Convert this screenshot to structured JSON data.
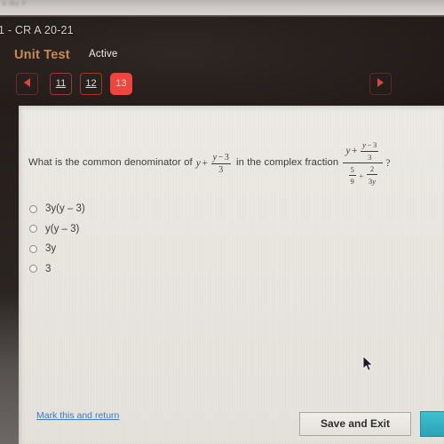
{
  "browser": {
    "ghost_tab_text": "e  My F"
  },
  "app": {
    "course_title": "1 - CR A 20-21",
    "assessment_label": "Unit Test",
    "status_label": "Active",
    "accent_orange": "#c98a55",
    "accent_red": "#f0453d"
  },
  "pager": {
    "prev_icon": "triangle-left-icon",
    "next_icon": "triangle-right-icon",
    "pages": [
      {
        "label": "11",
        "current": false
      },
      {
        "label": "12",
        "current": false
      },
      {
        "label": "13",
        "current": true
      }
    ]
  },
  "question": {
    "lead_text": "What is the common denominator of",
    "middle_text": "in the complex fraction",
    "trailing_text": "?",
    "expression": {
      "var": "y",
      "plus": "+",
      "frac_num_var": "y",
      "frac_num_minus": "−",
      "frac_num_const": "3",
      "frac_den": "3"
    },
    "complex_fraction": {
      "numerator": {
        "var": "y",
        "plus": "+",
        "frac_num_var": "y",
        "frac_num_minus": "−",
        "frac_num_const": "3",
        "frac_den": "3"
      },
      "denominator": {
        "left_num": "5",
        "left_den": "9",
        "plus": "+",
        "right_num": "2",
        "right_den_coef": "3",
        "right_den_var": "y"
      }
    }
  },
  "choices": [
    {
      "label": "3y(y – 3)",
      "selected": false
    },
    {
      "label": "y(y – 3)",
      "selected": false
    },
    {
      "label": "3y",
      "selected": false
    },
    {
      "label": "3",
      "selected": false
    }
  ],
  "footer": {
    "mark_return_label": "Mark this and return",
    "save_exit_label": "Save and Exit",
    "next_button_color": "#2fb0c2"
  }
}
